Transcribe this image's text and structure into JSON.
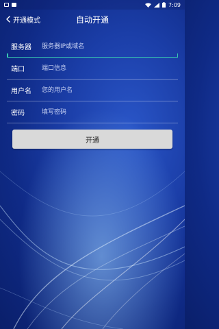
{
  "status_bar": {
    "time": "7:09",
    "icons": [
      "notification-icon",
      "sim-icon",
      "wifi-icon",
      "signal-icon",
      "battery-icon"
    ]
  },
  "app_bar": {
    "back_label": "开通模式",
    "title": "自动开通"
  },
  "form": {
    "server": {
      "label": "服务器",
      "placeholder": "服务器IP或域名",
      "value": ""
    },
    "port": {
      "label": "端口",
      "placeholder": "端口信息",
      "value": ""
    },
    "username": {
      "label": "用户名",
      "placeholder": "您的用户名",
      "value": ""
    },
    "password": {
      "label": "密码",
      "placeholder": "填写密码",
      "value": ""
    }
  },
  "submit_label": "开通",
  "colors": {
    "background": "#1b3ea8",
    "accent_underline": "#38c8b0",
    "button_bg": "#d9d9d9"
  }
}
